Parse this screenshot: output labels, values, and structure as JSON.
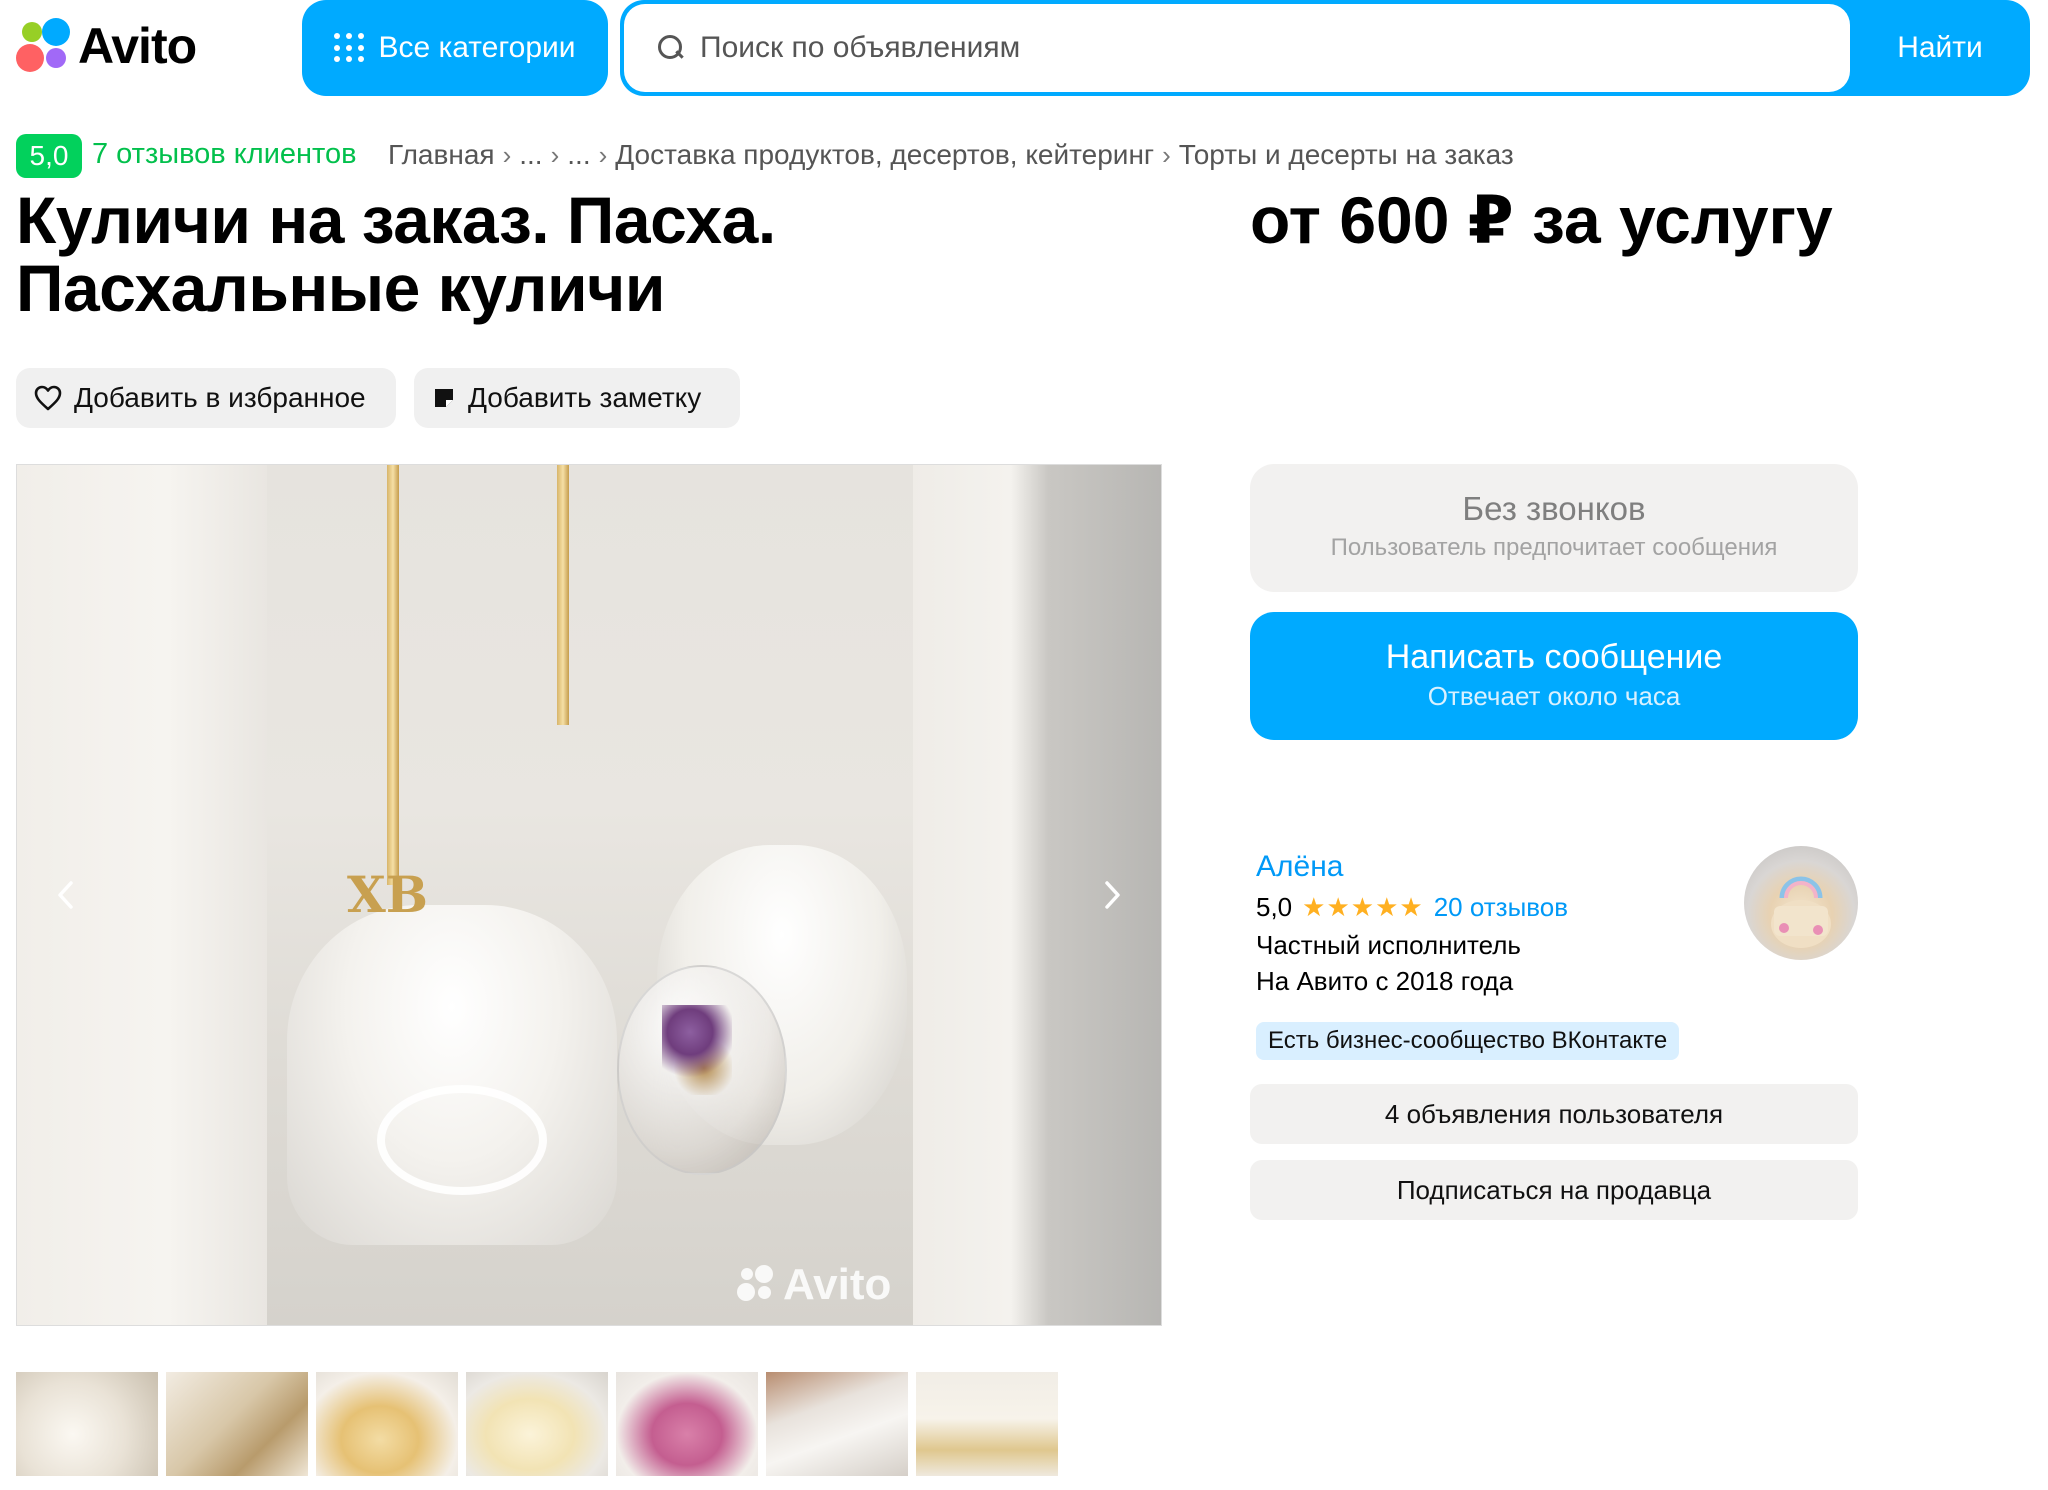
{
  "header": {
    "logo_text": "Avito",
    "all_categories_label": "Все категории",
    "search_placeholder": "Поиск по объявлениям",
    "search_value": "",
    "find_label": "Найти",
    "accent_color": "#00aaff"
  },
  "reviews": {
    "rating": "5,0",
    "label": "7 отзывов клиентов",
    "badge_color": "#02d15c"
  },
  "breadcrumb": [
    "Главная",
    "...",
    "...",
    "Доставка продуктов, десертов, кейтеринг",
    "Торты и десерты на заказ"
  ],
  "listing": {
    "title": "Куличи на заказ. Пасха. Пасхальные куличи",
    "price": "от 600 ₽ за услугу",
    "add_favorite_label": "Добавить в избранное",
    "add_note_label": "Добавить заметку",
    "watermark": "Avito",
    "thumbnail_count": 7
  },
  "contact": {
    "no_calls_title": "Без звонков",
    "no_calls_subtitle": "Пользователь предпочитает сообщения",
    "write_title": "Написать сообщение",
    "write_subtitle": "Отвечает около часа"
  },
  "seller": {
    "name": "Алёна",
    "rating": "5,0",
    "stars": "★★★★★",
    "reviews": "20 отзывов",
    "type": "Частный исполнитель",
    "since": "На Авито с 2018 года",
    "vk_badge": "Есть бизнес-сообщество ВКонтакте",
    "ads_button": "4 объявления пользователя",
    "subscribe_button": "Подписаться на продавца"
  },
  "icons": [
    "avito-logo-icon",
    "categories-grid-icon",
    "search-icon",
    "heart-icon",
    "note-icon",
    "chevron-left-icon",
    "chevron-right-icon"
  ]
}
